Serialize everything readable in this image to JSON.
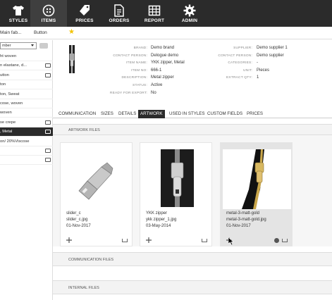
{
  "nav": {
    "items": [
      {
        "label": "STYLES",
        "icon": "shirt-icon"
      },
      {
        "label": "ITEMS",
        "icon": "button-icon"
      },
      {
        "label": "PRICES",
        "icon": "price-tags-icon"
      },
      {
        "label": "ORDERS",
        "icon": "document-icon"
      },
      {
        "label": "REPORT",
        "icon": "table-icon"
      },
      {
        "label": "ADMIN",
        "icon": "gear-icon"
      }
    ],
    "active_index": 1
  },
  "subbar": {
    "crumb1": "Main fab...",
    "crumb2": "Button"
  },
  "left_list": {
    "search_value": "mber",
    "items": [
      {
        "label": "ht woven",
        "chat": false
      },
      {
        "label": "n elastane, d...",
        "chat": true
      },
      {
        "label": "utton",
        "chat": true
      },
      {
        "label": "ton",
        "chat": false
      },
      {
        "label": "ton, Sweat",
        "chat": false
      },
      {
        "label": "cose, woven",
        "chat": false
      },
      {
        "label": "woven",
        "chat": false
      },
      {
        "label": "se crepe",
        "chat": true
      },
      {
        "label": ", Metal",
        "chat": true,
        "selected": true
      },
      {
        "label": "on/ 20%Viscose",
        "chat": false
      },
      {
        "label": "",
        "chat": true
      },
      {
        "label": "",
        "chat": true
      }
    ]
  },
  "details": {
    "left": [
      {
        "label": "BRAND:",
        "value": "Demo brand"
      },
      {
        "label": "CONTACT PERSON:",
        "value": "Delogue demo"
      },
      {
        "label": "ITEM NAME:",
        "value": "YKK zipper, Metal"
      },
      {
        "label": "ITEM NO:",
        "value": "666-1"
      },
      {
        "label": "DESCRIPTION:",
        "value": "Metal zipper"
      },
      {
        "label": "STATUS:",
        "value": "Active"
      },
      {
        "label": "READY FOR EXPORT:",
        "value": "No"
      }
    ],
    "right": [
      {
        "label": "SUPPLIER:",
        "value": "Demo supplier 1"
      },
      {
        "label": "CONTACT PERSON:",
        "value": "Demo supplier"
      },
      {
        "label": "CATEGORIES:",
        "value": "-"
      },
      {
        "label": "UNIT:",
        "value": "Pieces"
      },
      {
        "label": "EXTRACT QTY:",
        "value": "1"
      }
    ]
  },
  "tabs": [
    {
      "label": "COMMUNICATION"
    },
    {
      "label": "SIZES"
    },
    {
      "label": "DETAILS"
    },
    {
      "label": "ARTWORK",
      "active": true
    },
    {
      "label": "USED IN STYLES"
    },
    {
      "label": "CUSTOM FIELDS"
    },
    {
      "label": "PRICES"
    }
  ],
  "sections": {
    "artwork": "ARTWORK FILES",
    "communication": "COMMUNICATION FILES",
    "internal": "INTERNAL FILES"
  },
  "cards": [
    {
      "title": "slider_c",
      "filename": "slider_c.jpg",
      "date": "01-Nov-2017"
    },
    {
      "title": "YKK zipper",
      "filename": "ykk zipper_1.jpg",
      "date": "03-May-2014"
    },
    {
      "title": "metal-3-matt-gold",
      "filename": "metal-3-matt-gold.jpg",
      "date": "01-Nov-2017"
    }
  ]
}
